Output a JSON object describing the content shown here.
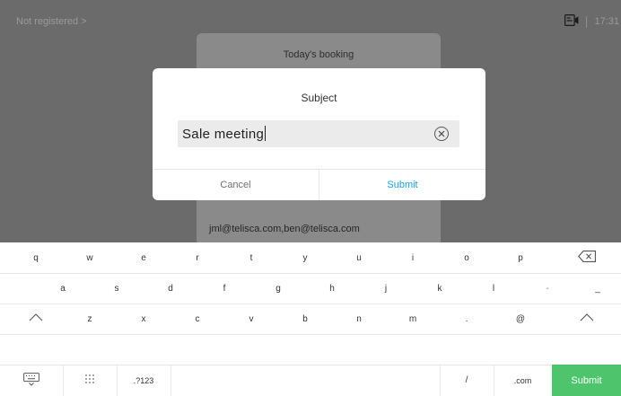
{
  "status": {
    "registration": "Not registered >",
    "time": "17:31"
  },
  "booking": {
    "title": "Today's booking",
    "emails": "jml@telisca.com,ben@telisca.com"
  },
  "modal": {
    "title": "Subject",
    "input_value": "Sale meeting",
    "cancel_label": "Cancel",
    "submit_label": "Submit"
  },
  "keyboard": {
    "row1": [
      "q",
      "w",
      "e",
      "r",
      "t",
      "y",
      "u",
      "i",
      "o",
      "p"
    ],
    "row2": [
      "a",
      "s",
      "d",
      "f",
      "g",
      "h",
      "j",
      "k",
      "l",
      "-",
      "_"
    ],
    "row3": [
      "z",
      "x",
      "c",
      "v",
      "b",
      "n",
      "m",
      ".",
      "@"
    ],
    "row4": {
      "numbers": ".?123",
      "slash": "/",
      "dotcom": ".com",
      "submit": "Submit"
    },
    "colors": {
      "submit": "#4ec46c",
      "accent": "#1ba0e2"
    }
  }
}
